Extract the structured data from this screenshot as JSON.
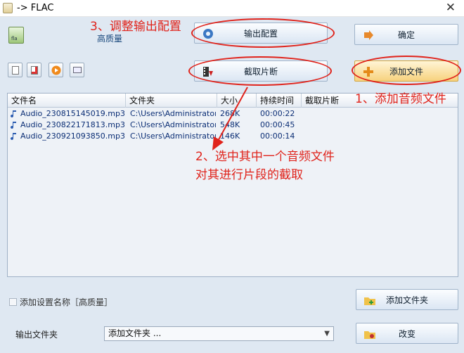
{
  "window": {
    "title": "-> FLAC",
    "close_glyph": "✕"
  },
  "profile": {
    "name": "高质量",
    "icon_label": "fla"
  },
  "buttons": {
    "output_config": "输出配置",
    "ok": "确定",
    "clip": "截取片断",
    "add_file": "添加文件",
    "add_folder": "添加文件夹",
    "change": "改变"
  },
  "toolbar_icons": [
    "clear-list-icon",
    "remove-file-icon",
    "play-icon",
    "info-icon"
  ],
  "table": {
    "columns": [
      "文件名",
      "文件夹",
      "大小",
      "持续时间",
      "截取片断"
    ],
    "rows": [
      {
        "name": "Audio_230815145019.mp3",
        "folder": "C:\\Users\\Administrator...",
        "size": "268K",
        "duration": "00:00:22",
        "clip": ""
      },
      {
        "name": "Audio_230822171813.mp3",
        "folder": "C:\\Users\\Administrator...",
        "size": "548K",
        "duration": "00:00:45",
        "clip": ""
      },
      {
        "name": "Audio_230921093850.mp3",
        "folder": "C:\\Users\\Administrator...",
        "size": "146K",
        "duration": "00:00:14",
        "clip": ""
      }
    ]
  },
  "options": {
    "add_profile_name_label": "添加设置名称［高质量］",
    "add_profile_name_checked": false,
    "output_folder_label": "输出文件夹",
    "output_folder_value": "添加文件夹 ..."
  },
  "annotations": {
    "step1": "1、添加音频文件",
    "step2_line1": "2、选中其中一个音频文件",
    "step2_line2": "对其进行片段的截取",
    "step3": "3、调整输出配置"
  },
  "colors": {
    "annotation": "#e0231b",
    "file_text": "#0b2e75",
    "window_bg": "#dfe8f2"
  }
}
